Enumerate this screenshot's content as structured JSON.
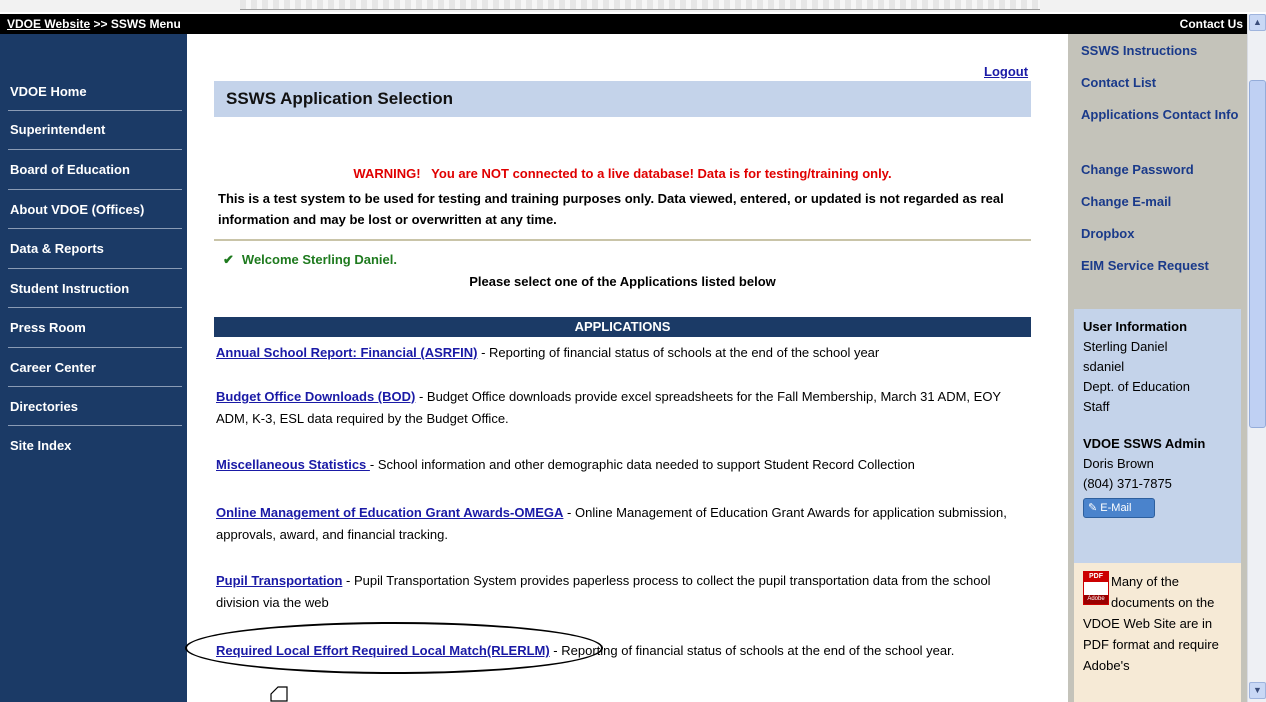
{
  "breadcrumb": {
    "link": "VDOE Website",
    "separator": " >> ",
    "current": "SSWS Menu"
  },
  "contact_us": "Contact Us",
  "left_nav": [
    "VDOE Home",
    "Superintendent",
    "Board of Education",
    "About VDOE (Offices)",
    "Data & Reports",
    "Student Instruction",
    "Press Room",
    "Career Center",
    "Directories",
    "Site Index"
  ],
  "main": {
    "logout": "Logout",
    "title": "SSWS Application Selection",
    "warning": "WARNING!   You are NOT connected to a live database! Data is for testing/training only.",
    "notice": "This is a test system to be used for testing and training purposes only. Data viewed, entered, or updated is not regarded as real information and may be lost or overwritten at any time.",
    "welcome": "Welcome Sterling Daniel.",
    "select_prompt": "Please select one of the Applications listed below",
    "applications_header": "APPLICATIONS",
    "applications": [
      {
        "name": "Annual School Report: Financial (ASRFIN)",
        "desc": " - Reporting of financial status of schools at the end of the school year"
      },
      {
        "name": "Budget Office Downloads (BOD)",
        "desc": " - Budget Office downloads provide excel spreadsheets for the Fall Membership, March 31 ADM, EOY ADM, K-3, ESL data required by the Budget Office."
      },
      {
        "name": "Miscellaneous Statistics ",
        "desc": " - School information and other demographic data needed to support Student Record Collection"
      },
      {
        "name": "Online Management of Education Grant Awards-OMEGA",
        "desc": " - Online Management of Education Grant Awards for application submission, approvals, award, and financial tracking."
      },
      {
        "name": "Pupil Transportation",
        "desc": " - Pupil Transportation System provides paperless process to collect the pupil transportation data from the school division via the web"
      },
      {
        "name": "Required Local Effort Required Local Match(RLERLM)",
        "desc": " - Reporting of financial status of schools at the end of the school year."
      }
    ]
  },
  "right_links": [
    "SSWS Instructions",
    "Contact List",
    "Applications Contact Info",
    "Change Password",
    "Change E-mail",
    "Dropbox",
    "EIM Service Request"
  ],
  "user_info": {
    "header": "User Information",
    "name": "Sterling Daniel",
    "username": "sdaniel",
    "org": "Dept. of Education",
    "role": "Staff"
  },
  "admin": {
    "header": "VDOE SSWS Admin",
    "name": "Doris Brown",
    "phone": "(804) 371-7875",
    "email_button": "E-Mail"
  },
  "pdf_note": {
    "icon_top": "PDF",
    "icon_bottom": "Adobe",
    "text": "Many of the documents on the VDOE Web Site are in PDF format and require Adobe's"
  },
  "colors": {
    "nav_blue": "#1b3a66",
    "title_bg": "#c4d3ea",
    "warning_red": "#e00000",
    "link_blue": "#1a1aa6",
    "right_bg": "#c4c3ba"
  }
}
